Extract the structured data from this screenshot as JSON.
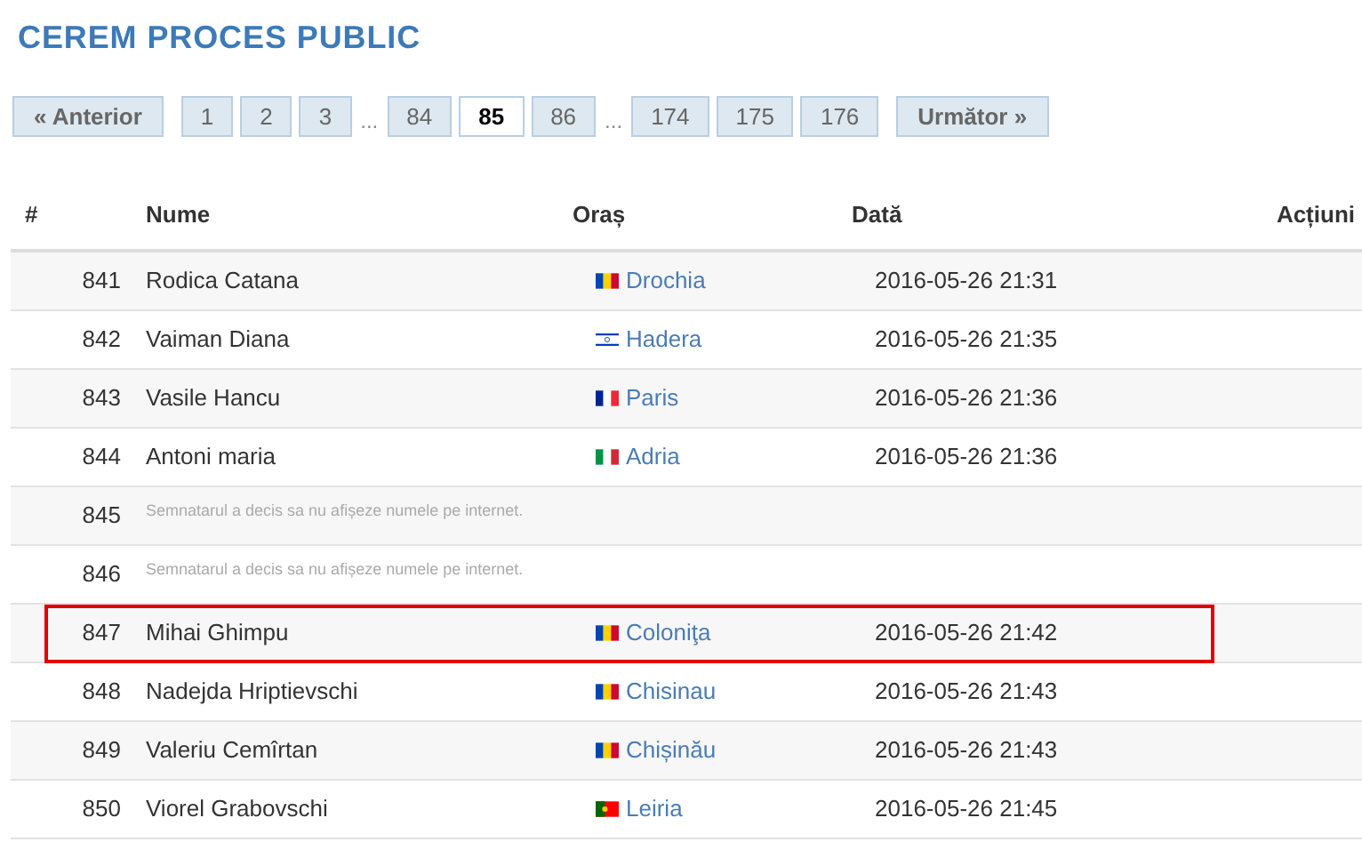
{
  "title": "CEREM PROCES PUBLIC",
  "pagination": [
    {
      "kind": "nav",
      "label": "« Anterior",
      "selected": false
    },
    {
      "kind": "page",
      "label": "1",
      "selected": false
    },
    {
      "kind": "page",
      "label": "2",
      "selected": false
    },
    {
      "kind": "page",
      "label": "3",
      "selected": false
    },
    {
      "kind": "gap",
      "label": "..."
    },
    {
      "kind": "page",
      "label": "84",
      "selected": false
    },
    {
      "kind": "page",
      "label": "85",
      "selected": true
    },
    {
      "kind": "page",
      "label": "86",
      "selected": false
    },
    {
      "kind": "gap",
      "label": "..."
    },
    {
      "kind": "page",
      "label": "174",
      "selected": false
    },
    {
      "kind": "page",
      "label": "175",
      "selected": false
    },
    {
      "kind": "page",
      "label": "176",
      "selected": false
    },
    {
      "kind": "nav",
      "label": "Următor »",
      "selected": false
    }
  ],
  "table": {
    "columns": [
      "#",
      "Nume",
      "Oraș",
      "Dată",
      "Acțiuni"
    ],
    "rows": [
      {
        "kind": "signer",
        "number": "841",
        "name": "Rodica Catana",
        "flag": {
          "kind": "md"
        },
        "city": "Drochia",
        "date": "2016-05-26 21:31",
        "highlighted": false
      },
      {
        "kind": "signer",
        "number": "842",
        "name": "Vaiman Diana",
        "flag": {
          "kind": "il"
        },
        "city": "Hadera",
        "date": "2016-05-26 21:35",
        "highlighted": false
      },
      {
        "kind": "signer",
        "number": "843",
        "name": "Vasile Hancu",
        "flag": {
          "kind": "fr"
        },
        "city": "Paris",
        "date": "2016-05-26 21:36",
        "highlighted": false
      },
      {
        "kind": "signer",
        "number": "844",
        "name": "Antoni maria",
        "flag": {
          "kind": "it"
        },
        "city": "Adria",
        "date": "2016-05-26 21:36",
        "highlighted": false
      },
      {
        "kind": "hidden",
        "number": "845",
        "note": "Semnatarul a decis sa nu afișeze numele pe internet."
      },
      {
        "kind": "hidden",
        "number": "846",
        "note": "Semnatarul a decis sa nu afișeze numele pe internet."
      },
      {
        "kind": "signer",
        "number": "847",
        "name": "Mihai Ghimpu",
        "flag": {
          "kind": "md"
        },
        "city": "Coloniţa",
        "date": "2016-05-26 21:42",
        "highlighted": true
      },
      {
        "kind": "signer",
        "number": "848",
        "name": "Nadejda Hriptievschi",
        "flag": {
          "kind": "md"
        },
        "city": "Chisinau",
        "date": "2016-05-26 21:43",
        "highlighted": false
      },
      {
        "kind": "signer",
        "number": "849",
        "name": "Valeriu Cemîrtan",
        "flag": {
          "kind": "md"
        },
        "city": "Chișinău",
        "date": "2016-05-26 21:43",
        "highlighted": false
      },
      {
        "kind": "signer",
        "number": "850",
        "name": "Viorel Grabovschi",
        "flag": {
          "kind": "pt"
        },
        "city": "Leiria",
        "date": "2016-05-26 21:45",
        "highlighted": false
      }
    ]
  }
}
